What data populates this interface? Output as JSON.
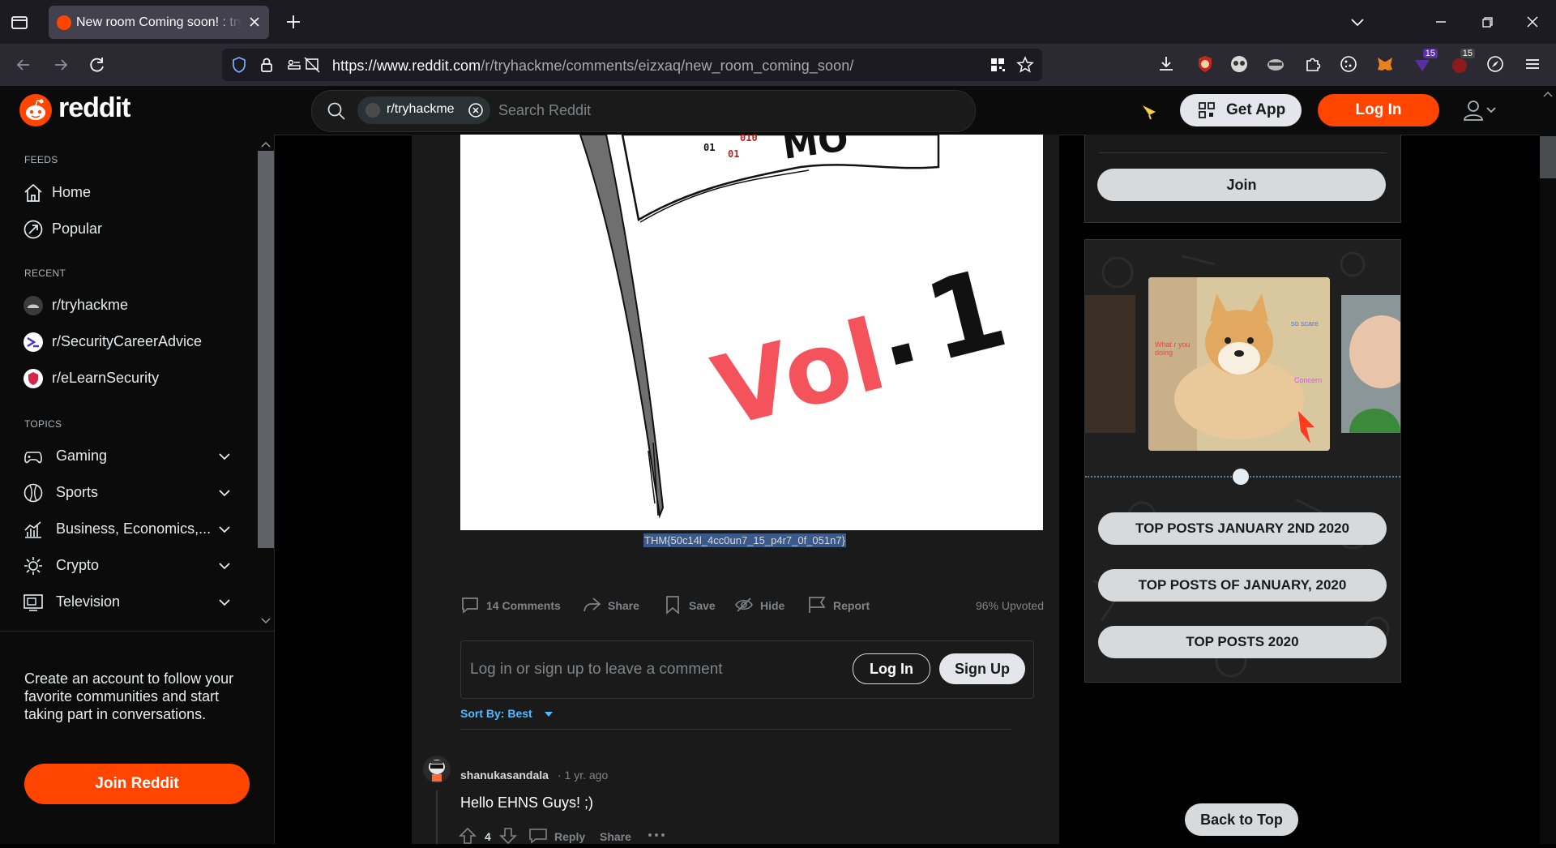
{
  "browser": {
    "tab_title": "New room Coming soon! : tryhackme",
    "url_host": "https://www.reddit.com",
    "url_path": "/r/tryhackme/comments/eizxaq/new_room_coming_soon/",
    "ext_badge_1": "15",
    "ext_badge_2": "15"
  },
  "header": {
    "logo_text": "reddit",
    "search_chip": "r/tryhackme",
    "search_placeholder": "Search Reddit",
    "get_app": "Get App",
    "login": "Log In"
  },
  "sidebar": {
    "feeds_label": "FEEDS",
    "feeds": [
      {
        "label": "Home",
        "icon": "home-icon"
      },
      {
        "label": "Popular",
        "icon": "popular-icon"
      }
    ],
    "recent_label": "RECENT",
    "recent": [
      {
        "label": "r/tryhackme"
      },
      {
        "label": "r/SecurityCareerAdvice"
      },
      {
        "label": "r/eLearnSecurity"
      }
    ],
    "topics_label": "TOPICS",
    "topics": [
      {
        "label": "Gaming",
        "icon": "gamepad-icon"
      },
      {
        "label": "Sports",
        "icon": "sports-icon"
      },
      {
        "label": "Business, Economics,...",
        "icon": "chart-icon"
      },
      {
        "label": "Crypto",
        "icon": "crypto-icon"
      },
      {
        "label": "Television",
        "icon": "tv-icon"
      }
    ],
    "cta_text": "Create an account to follow your favorite communities and start taking part in conversations.",
    "join_button": "Join Reddit"
  },
  "post": {
    "image_text": "Vol. 1",
    "image_binary": [
      "01",
      "01",
      "010"
    ],
    "caption": "THM{50c14l_4cc0un7_15_p4r7_0f_051n7}",
    "comments": "14 Comments",
    "share": "Share",
    "save": "Save",
    "hide": "Hide",
    "report": "Report",
    "upvoted": "96% Upvoted",
    "comment_placeholder": "Log in or sign up to leave a comment",
    "login": "Log In",
    "signup": "Sign Up",
    "sort_by": "Sort By: Best"
  },
  "comment": {
    "author": "shanukasandala",
    "time": "· 1 yr. ago",
    "body": "Hello EHNS Guys! ;)",
    "score": "4",
    "reply": "Reply",
    "share": "Share"
  },
  "right": {
    "join": "Join",
    "doge_text_1": "so scare",
    "doge_text_2": "What r you doing",
    "doge_text_3": "Concern",
    "top_posts": [
      "TOP POSTS JANUARY 2ND 2020",
      "TOP POSTS OF JANUARY, 2020",
      "TOP POSTS 2020"
    ],
    "back_to_top": "Back to Top"
  },
  "colors": {
    "brand": "#ff4500",
    "accent_link": "#4fbcff",
    "vol_red": "#f4535c"
  }
}
